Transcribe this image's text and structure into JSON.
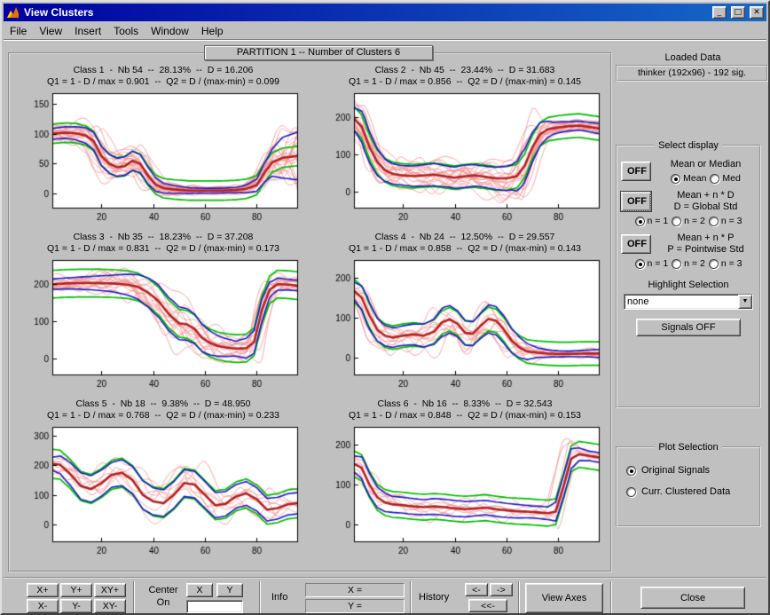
{
  "window": {
    "title": "View Clusters",
    "minimize_glyph": "_",
    "maximize_glyph": "□",
    "close_glyph": "✕"
  },
  "menu": {
    "items": [
      "File",
      "View",
      "Insert",
      "Tools",
      "Window",
      "Help"
    ]
  },
  "header": {
    "partition_label": "PARTITION 1  --  Number of Clusters 6"
  },
  "right_panel": {
    "loaded_data": {
      "label": "Loaded Data",
      "value": "thinker (192x96) - 192 sig."
    },
    "select_display": {
      "title": "Select display",
      "mean_row": {
        "off": "OFF",
        "label": "Mean or Median",
        "opt1": {
          "label": "Mean",
          "selected": true
        },
        "opt2": {
          "label": "Med",
          "selected": false
        }
      },
      "global_row": {
        "off": "OFF",
        "label1": "Mean  +  n * D",
        "label2": "D = Global Std",
        "opt1": {
          "label": "n = 1",
          "selected": true
        },
        "opt2": {
          "label": "n = 2",
          "selected": false
        },
        "opt3": {
          "label": "n = 3",
          "selected": false
        }
      },
      "pointwise_row": {
        "off": "OFF",
        "label1": "Mean  +  n * P",
        "label2": "P = Pointwise Std",
        "opt1": {
          "label": "n = 1",
          "selected": true
        },
        "opt2": {
          "label": "n = 2",
          "selected": false
        },
        "opt3": {
          "label": "n = 3",
          "selected": false
        }
      },
      "highlight_label": "Highlight Selection",
      "dropdown_value": "none",
      "dropdown_arrow": "▼",
      "signals_button": "Signals OFF"
    },
    "plot_selection": {
      "title": "Plot Selection",
      "opt1": {
        "label": "Original Signals",
        "selected": true
      },
      "opt2": {
        "label": "Curr. Clustered Data",
        "selected": false
      }
    }
  },
  "toolbar": {
    "zoom": [
      "X+",
      "Y+",
      "XY+",
      "X-",
      "Y-",
      "XY-"
    ],
    "center": {
      "line1": "Center",
      "line2": "On",
      "x": "X",
      "y": "Y",
      "value": ""
    },
    "info": {
      "label": "Info",
      "x_field": "X =",
      "y_field": "Y ="
    },
    "history": {
      "label": "History",
      "back": "<-",
      "fwd": "->",
      "fback": "<<-"
    },
    "view_axes": "View Axes",
    "close": "Close"
  },
  "chart_style": {
    "signal_color": "#f09090",
    "mean_color": "#b22222",
    "global_color": "#00bb00",
    "pointwise_color": "#1a1ac8",
    "axis_bg": "#ffffff",
    "axis_frame": "#000000"
  },
  "chart_data": [
    {
      "type": "line",
      "title1": "Class 1  -  Nb 54  --  28.13%  --  D = 16.206",
      "title2": "Q1 = 1 - D / max = 0.901  --  Q2 = D / (max-min) = 0.099",
      "xlim": [
        1,
        96
      ],
      "ylim": [
        -25,
        168
      ],
      "xticks": [
        20,
        40,
        60,
        80
      ],
      "yticks": [
        0,
        50,
        100,
        150
      ],
      "nb": 54,
      "D": 16.206,
      "mean": [
        [
          1,
          100
        ],
        [
          6,
          102
        ],
        [
          10,
          101
        ],
        [
          14,
          97
        ],
        [
          17,
          88
        ],
        [
          20,
          63
        ],
        [
          23,
          50
        ],
        [
          26,
          44
        ],
        [
          29,
          46
        ],
        [
          32,
          55
        ],
        [
          35,
          50
        ],
        [
          38,
          30
        ],
        [
          41,
          15
        ],
        [
          44,
          9
        ],
        [
          48,
          7
        ],
        [
          54,
          5
        ],
        [
          60,
          5
        ],
        [
          66,
          5
        ],
        [
          72,
          6
        ],
        [
          76,
          8
        ],
        [
          80,
          14
        ],
        [
          83,
          35
        ],
        [
          86,
          52
        ],
        [
          90,
          60
        ],
        [
          96,
          63
        ]
      ],
      "spread": [
        [
          1,
          9
        ],
        [
          8,
          10
        ],
        [
          14,
          13
        ],
        [
          20,
          16
        ],
        [
          26,
          15
        ],
        [
          32,
          16
        ],
        [
          38,
          14
        ],
        [
          44,
          8
        ],
        [
          52,
          5
        ],
        [
          60,
          4
        ],
        [
          68,
          4
        ],
        [
          74,
          5
        ],
        [
          80,
          10
        ],
        [
          85,
          20
        ],
        [
          90,
          34
        ],
        [
          96,
          40
        ]
      ]
    },
    {
      "type": "line",
      "title1": "Class 2  -  Nb 45  --  23.44%  --  D = 31.683",
      "title2": "Q1 = 1 - D / max = 0.856  --  Q2 = D / (max-min) = 0.145",
      "xlim": [
        1,
        96
      ],
      "ylim": [
        -45,
        265
      ],
      "xticks": [
        20,
        40,
        60,
        80
      ],
      "yticks": [
        0,
        100,
        200
      ],
      "nb": 45,
      "D": 31.683,
      "mean": [
        [
          1,
          197
        ],
        [
          4,
          175
        ],
        [
          7,
          120
        ],
        [
          10,
          80
        ],
        [
          13,
          58
        ],
        [
          16,
          48
        ],
        [
          20,
          44
        ],
        [
          24,
          42
        ],
        [
          28,
          44
        ],
        [
          32,
          46
        ],
        [
          36,
          42
        ],
        [
          40,
          38
        ],
        [
          44,
          42
        ],
        [
          48,
          44
        ],
        [
          52,
          40
        ],
        [
          56,
          36
        ],
        [
          60,
          36
        ],
        [
          64,
          42
        ],
        [
          67,
          70
        ],
        [
          70,
          120
        ],
        [
          73,
          155
        ],
        [
          76,
          168
        ],
        [
          80,
          173
        ],
        [
          84,
          176
        ],
        [
          88,
          178
        ],
        [
          92,
          174
        ],
        [
          96,
          170
        ]
      ],
      "spread": [
        [
          1,
          30
        ],
        [
          5,
          45
        ],
        [
          9,
          38
        ],
        [
          14,
          28
        ],
        [
          20,
          26
        ],
        [
          26,
          28
        ],
        [
          32,
          30
        ],
        [
          38,
          28
        ],
        [
          44,
          30
        ],
        [
          50,
          28
        ],
        [
          56,
          30
        ],
        [
          62,
          34
        ],
        [
          66,
          45
        ],
        [
          70,
          40
        ],
        [
          74,
          28
        ],
        [
          78,
          16
        ],
        [
          84,
          12
        ],
        [
          90,
          12
        ],
        [
          96,
          14
        ]
      ]
    },
    {
      "type": "line",
      "title1": "Class 3  -  Nb 35  --  18.23%  --  D = 37.208",
      "title2": "Q1 = 1 - D / max = 0.831  --  Q2 = D / (max-min) = 0.173",
      "xlim": [
        1,
        96
      ],
      "ylim": [
        -45,
        265
      ],
      "xticks": [
        20,
        40,
        60,
        80
      ],
      "yticks": [
        0,
        100,
        200
      ],
      "nb": 35,
      "D": 37.208,
      "mean": [
        [
          1,
          200
        ],
        [
          6,
          202
        ],
        [
          12,
          203
        ],
        [
          18,
          203
        ],
        [
          24,
          202
        ],
        [
          30,
          199
        ],
        [
          34,
          193
        ],
        [
          38,
          178
        ],
        [
          42,
          155
        ],
        [
          46,
          120
        ],
        [
          50,
          95
        ],
        [
          53,
          92
        ],
        [
          56,
          80
        ],
        [
          59,
          55
        ],
        [
          62,
          42
        ],
        [
          65,
          34
        ],
        [
          68,
          30
        ],
        [
          72,
          27
        ],
        [
          76,
          28
        ],
        [
          79,
          45
        ],
        [
          82,
          130
        ],
        [
          85,
          185
        ],
        [
          88,
          200
        ],
        [
          92,
          199
        ],
        [
          96,
          196
        ]
      ],
      "spread": [
        [
          1,
          14
        ],
        [
          8,
          15
        ],
        [
          16,
          18
        ],
        [
          24,
          22
        ],
        [
          32,
          30
        ],
        [
          40,
          42
        ],
        [
          48,
          45
        ],
        [
          54,
          42
        ],
        [
          60,
          35
        ],
        [
          66,
          26
        ],
        [
          72,
          20
        ],
        [
          78,
          30
        ],
        [
          82,
          30
        ],
        [
          86,
          18
        ],
        [
          92,
          14
        ],
        [
          96,
          14
        ]
      ]
    },
    {
      "type": "line",
      "title1": "Class 4  -  Nb 24  --  12.50%  --  D = 29.557",
      "title2": "Q1 = 1 - D / max = 0.858  --  Q2 = D / (max-min) = 0.143",
      "xlim": [
        1,
        96
      ],
      "ylim": [
        -45,
        245
      ],
      "xticks": [
        20,
        40,
        60,
        80
      ],
      "yticks": [
        0,
        100,
        200
      ],
      "nb": 24,
      "D": 29.557,
      "mean": [
        [
          1,
          168
        ],
        [
          4,
          150
        ],
        [
          7,
          105
        ],
        [
          10,
          70
        ],
        [
          13,
          55
        ],
        [
          16,
          50
        ],
        [
          20,
          55
        ],
        [
          24,
          58
        ],
        [
          28,
          55
        ],
        [
          32,
          65
        ],
        [
          35,
          88
        ],
        [
          38,
          96
        ],
        [
          41,
          85
        ],
        [
          44,
          62
        ],
        [
          47,
          60
        ],
        [
          50,
          80
        ],
        [
          53,
          97
        ],
        [
          56,
          92
        ],
        [
          59,
          70
        ],
        [
          62,
          42
        ],
        [
          65,
          25
        ],
        [
          68,
          15
        ],
        [
          72,
          12
        ],
        [
          76,
          10
        ],
        [
          80,
          9
        ],
        [
          85,
          9
        ],
        [
          90,
          10
        ],
        [
          96,
          10
        ]
      ],
      "spread": [
        [
          1,
          22
        ],
        [
          6,
          35
        ],
        [
          12,
          26
        ],
        [
          18,
          24
        ],
        [
          24,
          26
        ],
        [
          30,
          30
        ],
        [
          36,
          36
        ],
        [
          42,
          32
        ],
        [
          48,
          30
        ],
        [
          54,
          36
        ],
        [
          60,
          34
        ],
        [
          66,
          24
        ],
        [
          72,
          12
        ],
        [
          78,
          8
        ],
        [
          84,
          7
        ],
        [
          90,
          8
        ],
        [
          96,
          10
        ]
      ]
    },
    {
      "type": "line",
      "title1": "Class 5  -  Nb 18  --  9.38%  --  D = 48.950",
      "title2": "Q1 = 1 - D / max = 0.768  --  Q2 = D / (max-min) = 0.233",
      "xlim": [
        1,
        96
      ],
      "ylim": [
        -60,
        330
      ],
      "xticks": [
        20,
        40,
        60,
        80
      ],
      "yticks": [
        0,
        100,
        200,
        300
      ],
      "nb": 18,
      "D": 48.95,
      "mean": [
        [
          1,
          205
        ],
        [
          4,
          202
        ],
        [
          8,
          170
        ],
        [
          12,
          130
        ],
        [
          16,
          120
        ],
        [
          20,
          140
        ],
        [
          24,
          168
        ],
        [
          28,
          175
        ],
        [
          32,
          150
        ],
        [
          36,
          100
        ],
        [
          40,
          78
        ],
        [
          44,
          72
        ],
        [
          48,
          100
        ],
        [
          52,
          140
        ],
        [
          56,
          135
        ],
        [
          60,
          100
        ],
        [
          64,
          65
        ],
        [
          68,
          70
        ],
        [
          72,
          95
        ],
        [
          76,
          105
        ],
        [
          80,
          85
        ],
        [
          84,
          50
        ],
        [
          88,
          55
        ],
        [
          92,
          68
        ],
        [
          96,
          72
        ]
      ],
      "spread": [
        [
          1,
          22
        ],
        [
          6,
          35
        ],
        [
          12,
          45
        ],
        [
          18,
          45
        ],
        [
          24,
          42
        ],
        [
          30,
          45
        ],
        [
          36,
          48
        ],
        [
          42,
          45
        ],
        [
          48,
          45
        ],
        [
          54,
          45
        ],
        [
          60,
          45
        ],
        [
          66,
          42
        ],
        [
          72,
          40
        ],
        [
          78,
          40
        ],
        [
          84,
          38
        ],
        [
          90,
          36
        ],
        [
          96,
          36
        ]
      ]
    },
    {
      "type": "line",
      "title1": "Class 6  -  Nb 16  --  8.33%  --  D = 32.543",
      "title2": "Q1 = 1 - D / max = 0.848  --  Q2 = D / (max-min) = 0.153",
      "xlim": [
        1,
        96
      ],
      "ylim": [
        -45,
        245
      ],
      "xticks": [
        20,
        40,
        60,
        80
      ],
      "yticks": [
        0,
        100,
        200
      ],
      "nb": 16,
      "D": 32.543,
      "mean": [
        [
          1,
          152
        ],
        [
          4,
          142
        ],
        [
          7,
          100
        ],
        [
          10,
          68
        ],
        [
          13,
          55
        ],
        [
          16,
          50
        ],
        [
          20,
          48
        ],
        [
          24,
          45
        ],
        [
          28,
          43
        ],
        [
          32,
          45
        ],
        [
          36,
          43
        ],
        [
          40,
          40
        ],
        [
          44,
          38
        ],
        [
          48,
          40
        ],
        [
          52,
          42
        ],
        [
          56,
          38
        ],
        [
          60,
          35
        ],
        [
          64,
          33
        ],
        [
          68,
          32
        ],
        [
          72,
          30
        ],
        [
          76,
          28
        ],
        [
          79,
          32
        ],
        [
          82,
          95
        ],
        [
          85,
          165
        ],
        [
          88,
          176
        ],
        [
          92,
          172
        ],
        [
          96,
          168
        ]
      ],
      "spread": [
        [
          1,
          20
        ],
        [
          5,
          30
        ],
        [
          10,
          26
        ],
        [
          16,
          20
        ],
        [
          22,
          20
        ],
        [
          28,
          19
        ],
        [
          34,
          20
        ],
        [
          40,
          20
        ],
        [
          46,
          19
        ],
        [
          52,
          18
        ],
        [
          58,
          18
        ],
        [
          64,
          17
        ],
        [
          70,
          15
        ],
        [
          76,
          16
        ],
        [
          80,
          26
        ],
        [
          84,
          28
        ],
        [
          88,
          16
        ],
        [
          92,
          12
        ],
        [
          96,
          12
        ]
      ]
    }
  ]
}
